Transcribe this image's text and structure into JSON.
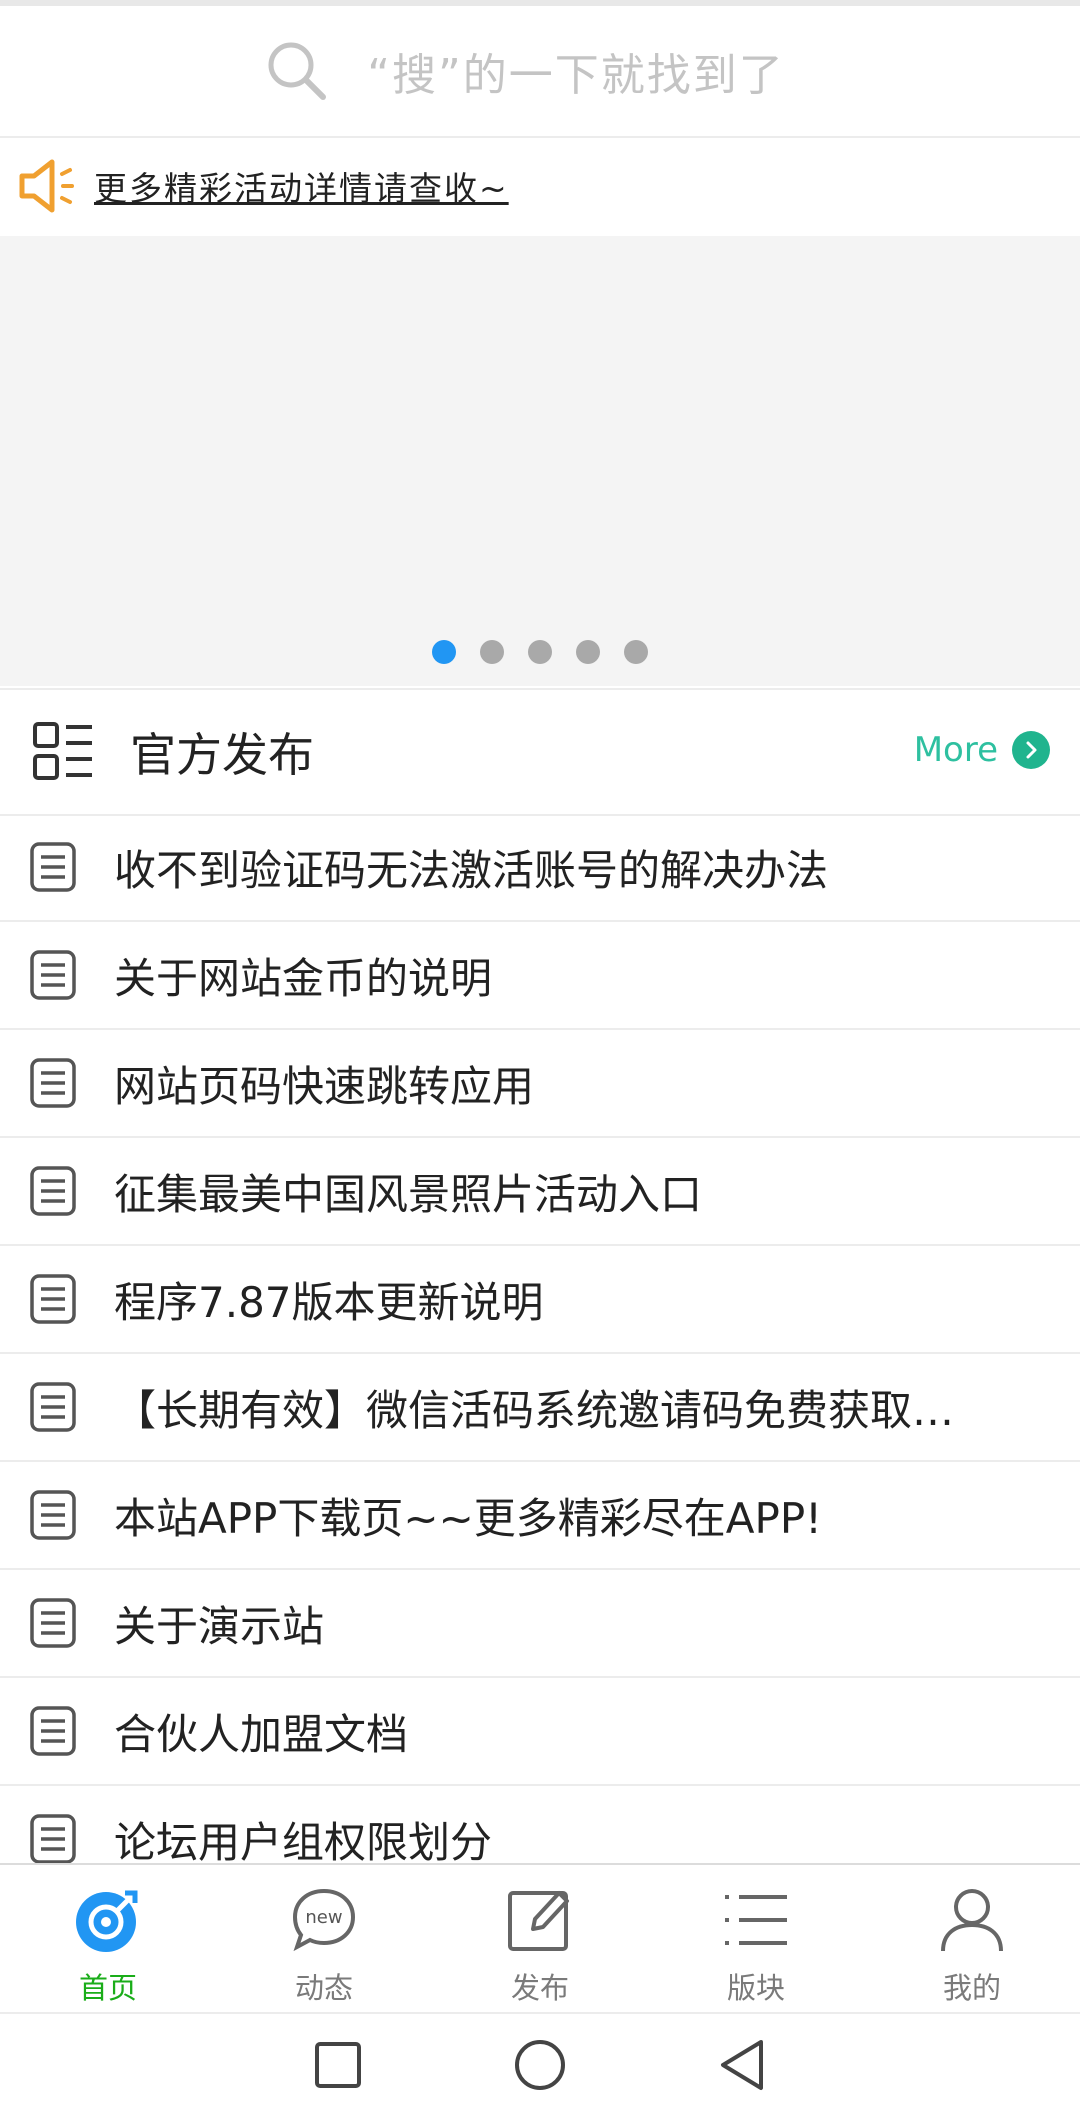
{
  "search": {
    "placeholder": "“搜”的一下就找到了"
  },
  "notice": {
    "text": "更多精彩活动详情请查收~"
  },
  "banner": {
    "slide_count": 5,
    "active_index": 0
  },
  "official": {
    "title": "官方发布",
    "more_label": "More"
  },
  "posts": [
    "收不到验证码无法激活账号的解决办法",
    "关于网站金币的说明",
    "网站页码快速跳转应用",
    "征集最美中国风景照片活动入口",
    "程序7.87版本更新说明",
    "【长期有效】微信活码系统邀请码免费获取…",
    "本站APP下载页~~更多精彩尽在APP!",
    "关于演示站",
    "合伙人加盟文档",
    "论坛用户组权限划分"
  ],
  "tabs": [
    {
      "label": "首页",
      "icon": "home-compass-icon",
      "active": true
    },
    {
      "label": "动态",
      "icon": "new-chat-icon",
      "active": false
    },
    {
      "label": "发布",
      "icon": "edit-icon",
      "active": false
    },
    {
      "label": "版块",
      "icon": "list-icon",
      "active": false
    },
    {
      "label": "我的",
      "icon": "user-icon",
      "active": false
    }
  ],
  "colors": {
    "accent_blue": "#2196f3",
    "active_tab_green": "#1aad19",
    "more_teal": "#20b48e",
    "notice_orange": "#f0a030"
  }
}
